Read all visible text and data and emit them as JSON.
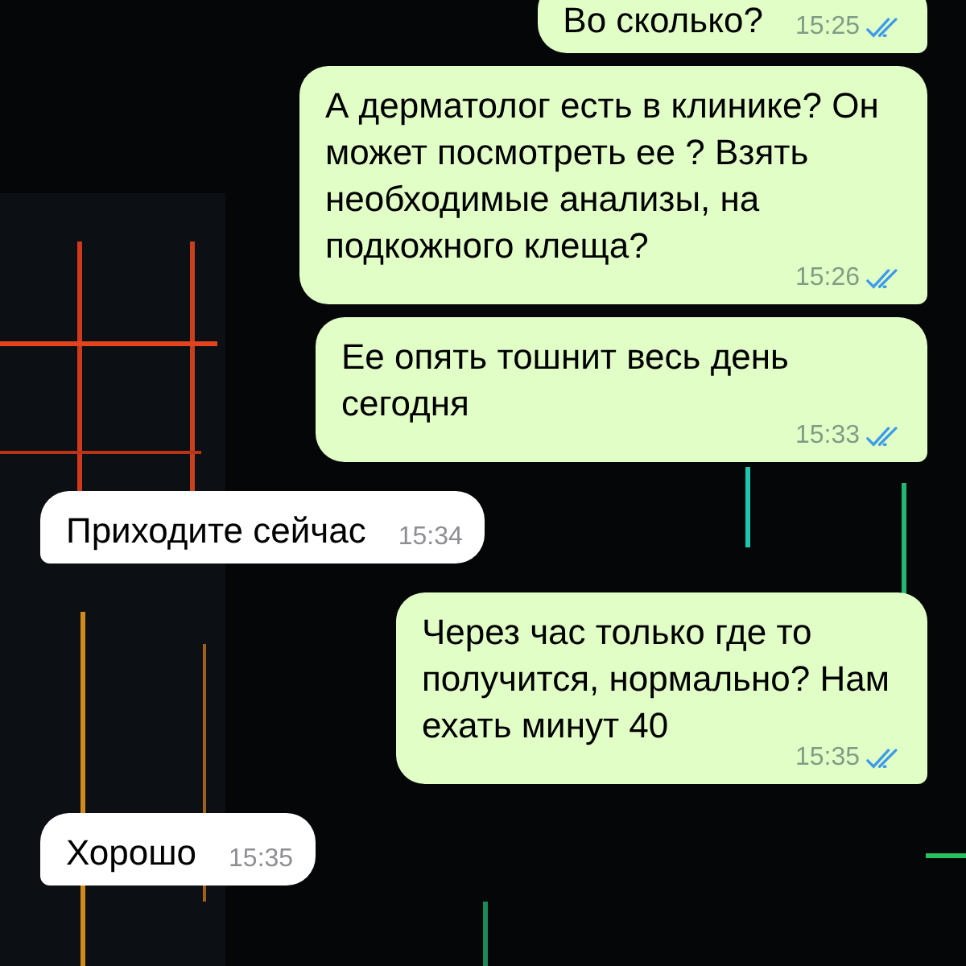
{
  "messages": [
    {
      "kind": "sent",
      "text": "Во сколько?",
      "time": "15:25",
      "read": true
    },
    {
      "kind": "sent",
      "text": "А дерматолог есть в клинике? Он может посмотреть ее ? Взять необходимые анализы, на подкожного клеща?",
      "time": "15:26",
      "read": true
    },
    {
      "kind": "sent",
      "text": "Ее опять тошнит весь день сегодня",
      "time": "15:33",
      "read": true
    },
    {
      "kind": "received",
      "text": "Приходите сейчас",
      "time": "15:34"
    },
    {
      "kind": "sent",
      "text": "Через час только где то получится, нормально? Нам ехать минут 40",
      "time": "15:35",
      "read": true
    },
    {
      "kind": "received",
      "text": "Хорошо",
      "time": "15:35"
    }
  ]
}
